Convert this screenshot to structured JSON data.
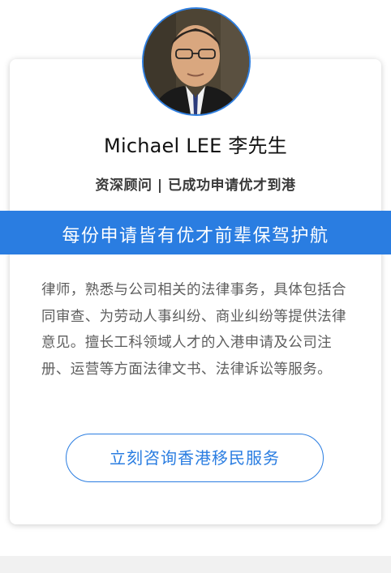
{
  "profile": {
    "name": "Michael LEE 李先生",
    "subtitle": "资深顾问 | 已成功申请优才到港",
    "avatar_icon": "person-portrait"
  },
  "banner": {
    "text": "每份申请皆有优才前辈保驾护航",
    "color": "#2a7de1"
  },
  "description": "律师，熟悉与公司相关的法律事务，具体包括合同审查、为劳动人事纠纷、商业纠纷等提供法律意见。擅长工科领域人才的入港申请及公司注册、运营等方面法律文书、法律诉讼等服务。",
  "cta": {
    "label": "立刻咨询香港移民服务"
  },
  "colors": {
    "accent": "#2a7de1",
    "text": "#5e5e5e",
    "name": "#111111",
    "page_bottom": "#f1f1f1"
  }
}
